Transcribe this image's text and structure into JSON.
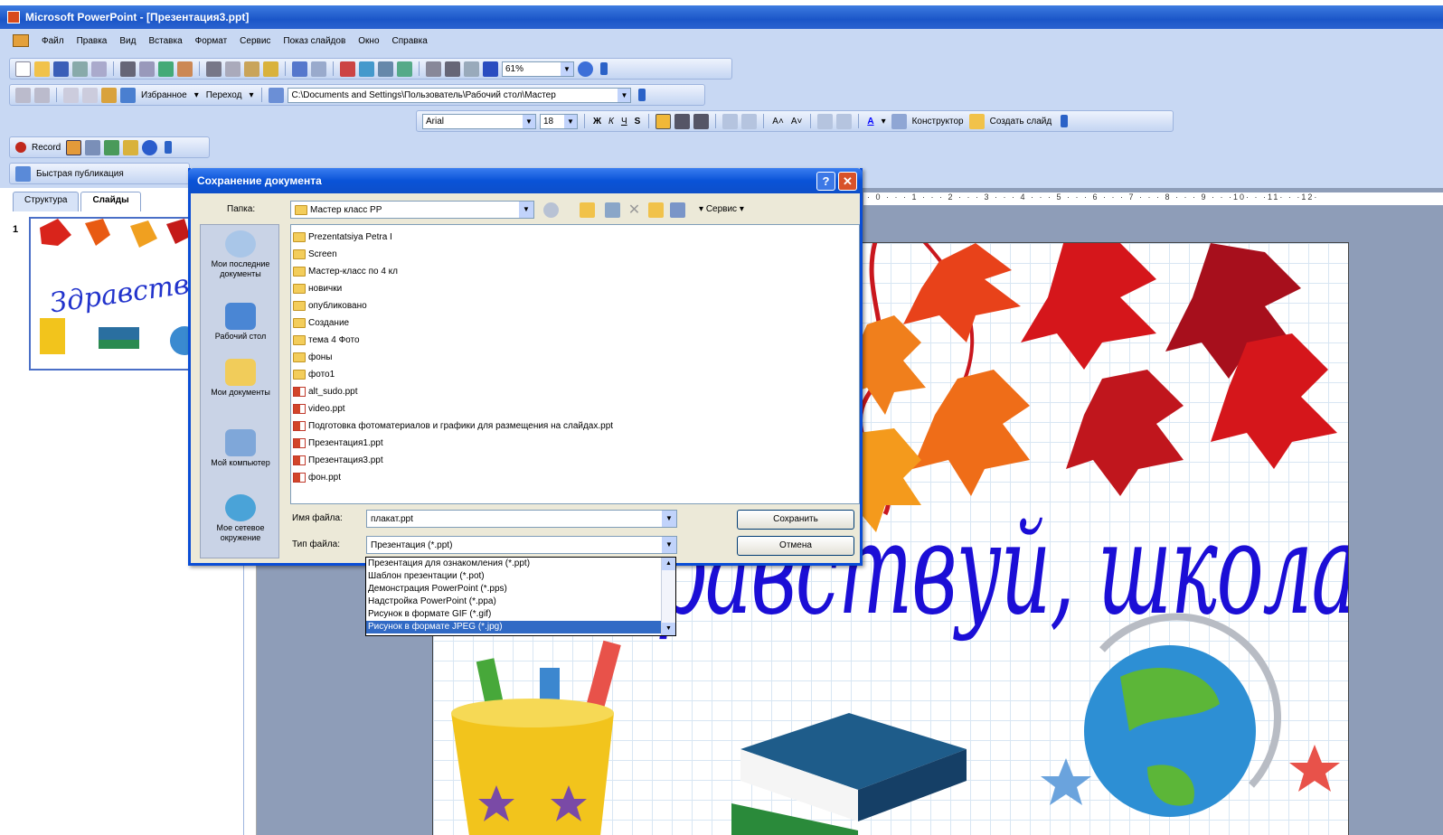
{
  "window": {
    "title": "Microsoft PowerPoint - [Презентация3.ppt]"
  },
  "menu": [
    "Файл",
    "Правка",
    "Вид",
    "Вставка",
    "Формат",
    "Сервис",
    "Показ слайдов",
    "Окно",
    "Справка"
  ],
  "toolbar": {
    "zoom": "61%"
  },
  "web_toolbar": {
    "favorites": "Избранное",
    "goto": "Переход",
    "address": "C:\\Documents and Settings\\Пользователь\\Рабочий стол\\Мастер"
  },
  "format_toolbar": {
    "font": "Arial",
    "size": "18",
    "designer": "Конструктор",
    "new_slide": "Создать слайд"
  },
  "extra_toolbar": {
    "record": "Record"
  },
  "publish_toolbar": {
    "quick_publish": "Быстрая публикация"
  },
  "panel_tabs": [
    "Структура",
    "Слайды"
  ],
  "slide_number": "1",
  "ruler_text": "· 0 · · · 1 · · · 2 · · · 3 · · · 4 · · · 5 · · · 6 · · · 7 · · · 8 · · · 9 · · ·10· · ·11· · ·12·",
  "slide": {
    "title": "Здравствуй, школа!"
  },
  "thumbnail": {
    "title": "Здравствуй, школа"
  },
  "dialog": {
    "title": "Сохранение документа",
    "folder_label": "Папка:",
    "folder": "Мастер класс PP",
    "service": "Сервис",
    "places": [
      {
        "label": "Мои последние документы",
        "icon": "recent-documents-icon"
      },
      {
        "label": "Рабочий стол",
        "icon": "desktop-icon"
      },
      {
        "label": "Мои документы",
        "icon": "my-documents-icon"
      },
      {
        "label": "Мой компьютер",
        "icon": "my-computer-icon"
      },
      {
        "label": "Мое сетевое окружение",
        "icon": "network-places-icon"
      }
    ],
    "files": [
      {
        "name": "Prezentatsiya Petra I",
        "type": "folder"
      },
      {
        "name": "Screen",
        "type": "folder"
      },
      {
        "name": "Мастер-класс по 4 кл",
        "type": "folder"
      },
      {
        "name": "новички",
        "type": "folder"
      },
      {
        "name": "опубликовано",
        "type": "folder"
      },
      {
        "name": "Создание",
        "type": "folder"
      },
      {
        "name": "тема 4 Фото",
        "type": "folder"
      },
      {
        "name": "фоны",
        "type": "folder"
      },
      {
        "name": "фото1",
        "type": "folder"
      },
      {
        "name": "alt_sudo.ppt",
        "type": "ppt"
      },
      {
        "name": "video.ppt",
        "type": "ppt"
      },
      {
        "name": "Подготовка фотоматериалов и графики для размещения на слайдах.ppt",
        "type": "ppt"
      },
      {
        "name": "Презентация1.ppt",
        "type": "ppt"
      },
      {
        "name": "Презентация3.ppt",
        "type": "ppt"
      },
      {
        "name": "фон.ppt",
        "type": "ppt"
      }
    ],
    "filename_label": "Имя файла:",
    "filename": "плакат.ppt",
    "filetype_label": "Тип файла:",
    "filetype": "Презентация (*.ppt)",
    "save_button": "Сохранить",
    "cancel_button": "Отмена",
    "filetype_options": [
      "Презентация для ознакомления (*.ppt)",
      "Шаблон презентации (*.pot)",
      "Демонстрация PowerPoint (*.pps)",
      "Надстройка PowerPoint (*.ppa)",
      "Рисунок в формате GIF (*.gif)",
      "Рисунок в формате JPEG (*.jpg)"
    ],
    "selected_option": 5
  }
}
